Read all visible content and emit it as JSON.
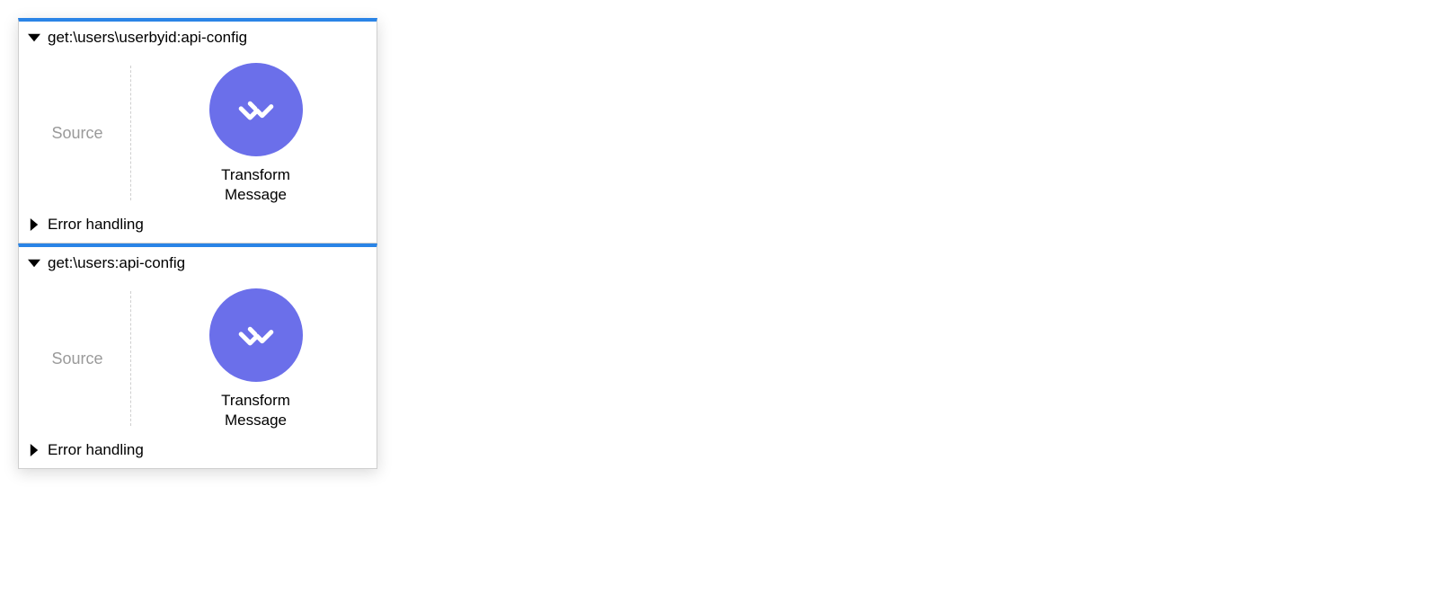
{
  "flows": [
    {
      "title": "get:\\users\\userbyid:api-config",
      "source_label": "Source",
      "component": {
        "icon": "dataweave-icon",
        "label": "Transform\nMessage"
      },
      "error_label": "Error handling",
      "expanded": true,
      "error_expanded": false
    },
    {
      "title": "get:\\users:api-config",
      "source_label": "Source",
      "component": {
        "icon": "dataweave-icon",
        "label": "Transform\nMessage"
      },
      "error_label": "Error handling",
      "expanded": true,
      "error_expanded": false
    }
  ],
  "colors": {
    "accent_top": "#2a84e6",
    "component": "#6b6fea"
  }
}
